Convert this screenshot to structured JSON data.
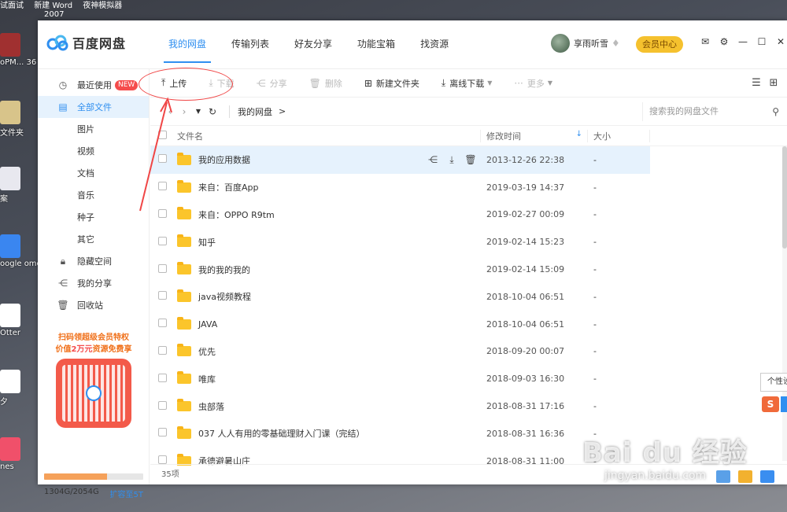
{
  "desktop": {
    "top_texts": [
      "试面试",
      "新建 Word",
      "夜神模拟器",
      "2007"
    ],
    "icons": [
      {
        "label": "oPM... 36",
        "color": "#a03030"
      },
      {
        "label": "文件夹",
        "color": "#d8c48a"
      },
      {
        "label": "案",
        "color": "#e8e8ef"
      },
      {
        "label": "oogle ome",
        "color": "#3a86f0"
      },
      {
        "label": "Otter",
        "color": "#ffffff"
      },
      {
        "label": "夕",
        "color": "#ffffff"
      },
      {
        "label": "nes",
        "color": "#f0506a"
      }
    ]
  },
  "app": {
    "logo_text": "百度网盘",
    "nav_tabs": [
      "我的网盘",
      "传输列表",
      "好友分享",
      "功能宝箱",
      "找资源"
    ],
    "active_tab": "我的网盘",
    "username": "享雨听雪",
    "vip_label": "会员中心",
    "accent_color": "#2f8ff0"
  },
  "sidebar": {
    "recent": {
      "label": "最近使用",
      "badge": "NEW"
    },
    "all_files": "全部文件",
    "categories": [
      "图片",
      "视频",
      "文档",
      "音乐",
      "种子",
      "其它"
    ],
    "hidden_space": "隐藏空间",
    "my_share": "我的分享",
    "recycle_bin": "回收站",
    "promo_line1": "扫码领超级会员特权",
    "promo_line2_pre": "价值",
    "promo_line2_em": "2万元",
    "promo_line2_post": "资源免费享",
    "storage_used_fraction": 0.637,
    "storage_text": "1304G/2054G",
    "expand_label": "扩容至5T"
  },
  "toolbar": {
    "upload": "上传",
    "download": "下载",
    "share": "分享",
    "delete": "删除",
    "new_folder": "新建文件夹",
    "offline_download": "离线下载",
    "more": "更多"
  },
  "address": {
    "breadcrumb": "我的网盘",
    "separator": ">",
    "search_placeholder": "搜索我的网盘文件"
  },
  "table": {
    "headers": {
      "name": "文件名",
      "time": "修改时间",
      "size": "大小"
    },
    "rows": [
      {
        "name": "我的应用数据",
        "time": "2013-12-26 22:38",
        "size": "-"
      },
      {
        "name": "来自：百度App",
        "time": "2019-03-19 14:37",
        "size": "-"
      },
      {
        "name": "来自：OPPO R9tm",
        "time": "2019-02-27 00:09",
        "size": "-"
      },
      {
        "name": "知乎",
        "time": "2019-02-14 15:23",
        "size": "-"
      },
      {
        "name": "我的我的我的",
        "time": "2019-02-14 15:09",
        "size": "-"
      },
      {
        "name": "java视频教程",
        "time": "2018-10-04 06:51",
        "size": "-"
      },
      {
        "name": "JAVA",
        "time": "2018-10-04 06:51",
        "size": "-"
      },
      {
        "name": "优先",
        "time": "2018-09-20 00:07",
        "size": "-"
      },
      {
        "name": "唯库",
        "time": "2018-09-03 16:30",
        "size": "-"
      },
      {
        "name": "虫部落",
        "time": "2018-08-31 17:16",
        "size": "-"
      },
      {
        "name": "037 人人有用的零基础理财入门课（完结）",
        "time": "2018-08-31 16:36",
        "size": "-"
      },
      {
        "name": "承德避暑山庄",
        "time": "2018-08-31 11:00",
        "size": "-"
      }
    ],
    "item_count": "35项"
  },
  "overlay": {
    "tooltip": "个性设",
    "watermark_big": "Bai du 经验",
    "watermark_small": "jingyan.baidu.com"
  }
}
